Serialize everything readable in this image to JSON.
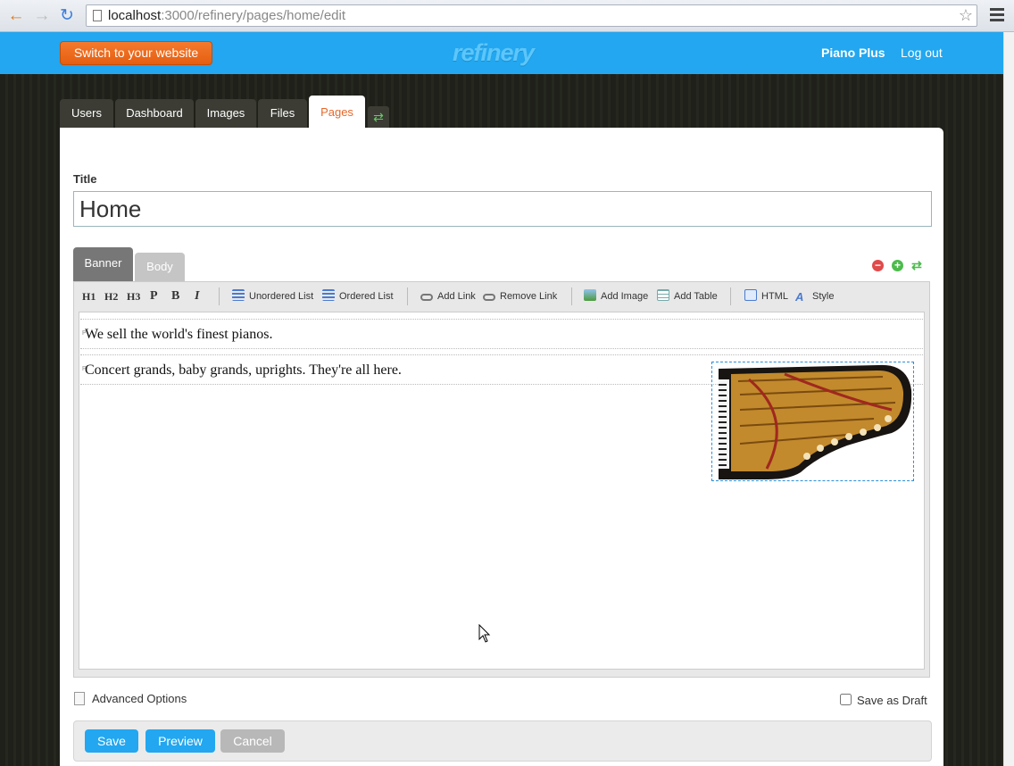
{
  "browser": {
    "url_host": "localhost",
    "url_path": ":3000/refinery/pages/home/edit"
  },
  "adminbar": {
    "switch_label": "Switch to your website",
    "logo_text": "refinery",
    "site_name": "Piano Plus",
    "logout_label": "Log out"
  },
  "tabs": [
    {
      "label": "Users"
    },
    {
      "label": "Dashboard"
    },
    {
      "label": "Images"
    },
    {
      "label": "Files"
    },
    {
      "label": "Pages",
      "active": true
    }
  ],
  "form": {
    "title_label": "Title",
    "title_value": "Home"
  },
  "part_tabs": [
    {
      "label": "Banner",
      "active": true
    },
    {
      "label": "Body"
    }
  ],
  "toolbar": {
    "h1": "H1",
    "h2": "H2",
    "h3": "H3",
    "p": "P",
    "bold": "B",
    "italic": "I",
    "unordered_list": "Unordered List",
    "ordered_list": "Ordered List",
    "add_link": "Add Link",
    "remove_link": "Remove Link",
    "add_image": "Add Image",
    "add_table": "Add Table",
    "html": "HTML",
    "style": "Style"
  },
  "content": {
    "para_marker": "P",
    "para1": "We sell the world's finest pianos.",
    "para2": "Concert grands, baby grands, uprights. They're all here."
  },
  "options": {
    "advanced_label": "Advanced Options",
    "draft_label": "Save as Draft",
    "draft_checked": false
  },
  "actions": {
    "save": "Save",
    "preview": "Preview",
    "cancel": "Cancel"
  },
  "colors": {
    "adminbar": "#22a7f0",
    "switch_button": "#e55e10",
    "active_tab_text": "#e5682a",
    "primary_button": "#22a7f0"
  }
}
